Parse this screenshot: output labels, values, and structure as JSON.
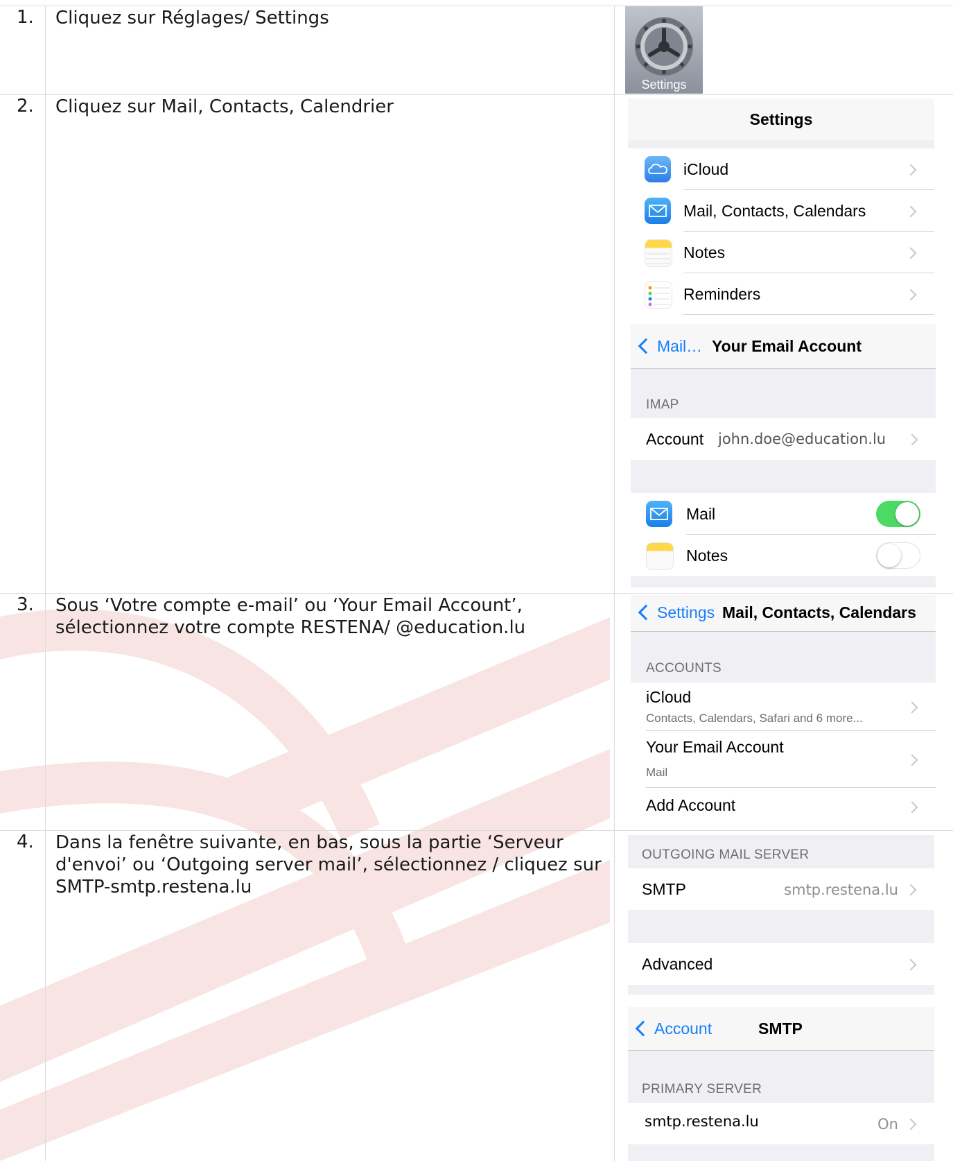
{
  "steps": [
    {
      "number": "1.",
      "text": "Cliquez sur Réglages/ Settings"
    },
    {
      "number": "2.",
      "text": "Cliquez sur Mail, Contacts, Calendrier"
    },
    {
      "number": "3.",
      "text": "Sous ‘Votre compte e-mail’ ou ‘Your Email Account’, sélectionnez votre compte RESTENA/ @education.lu"
    },
    {
      "number": "4.",
      "text": "Dans la fenêtre suivante, en bas, sous la partie ‘Serveur d'envoi’ ou ‘Outgoing server mail’, sélectionnez / cliquez sur SMTP-smtp.restena.lu"
    }
  ],
  "settings_icon": {
    "label": "Settings",
    "icon": "gear-icon"
  },
  "settings_screen": {
    "title": "Settings",
    "items": [
      {
        "label": "iCloud",
        "icon": "icloud-icon"
      },
      {
        "label": "Mail, Contacts, Calendars",
        "icon": "mail-icon"
      },
      {
        "label": "Notes",
        "icon": "notes-icon"
      },
      {
        "label": "Reminders",
        "icon": "reminders-icon"
      }
    ]
  },
  "account_screen": {
    "back_label": "Mail…",
    "title": "Your Email Account",
    "section": "IMAP",
    "account_label": "Account",
    "account_value": "john.doe@education.lu",
    "toggles": [
      {
        "label": "Mail",
        "icon": "mail-icon",
        "on": true
      },
      {
        "label": "Notes",
        "icon": "notes-icon",
        "on": false
      }
    ]
  },
  "mcc_screen": {
    "back_label": "Settings",
    "title": "Mail, Contacts, Calendars",
    "section": "ACCOUNTS",
    "accounts": [
      {
        "label": "iCloud",
        "sub": "Contacts, Calendars, Safari and 6 more..."
      },
      {
        "label": "Your Email Account",
        "sub": "Mail"
      },
      {
        "label": "Add Account",
        "sub": ""
      }
    ]
  },
  "outgoing_screen": {
    "section": "OUTGOING MAIL SERVER",
    "smtp_label": "SMTP",
    "smtp_value": "smtp.restena.lu",
    "advanced_label": "Advanced"
  },
  "smtp_screen": {
    "back_label": "Account",
    "title": "SMTP",
    "section": "PRIMARY SERVER",
    "server_label": "smtp.restena.lu",
    "server_value": "On"
  },
  "colors": {
    "ios_blue": "#157efb",
    "toggle_on": "#4cd964",
    "watermark": "#f4e0df"
  }
}
